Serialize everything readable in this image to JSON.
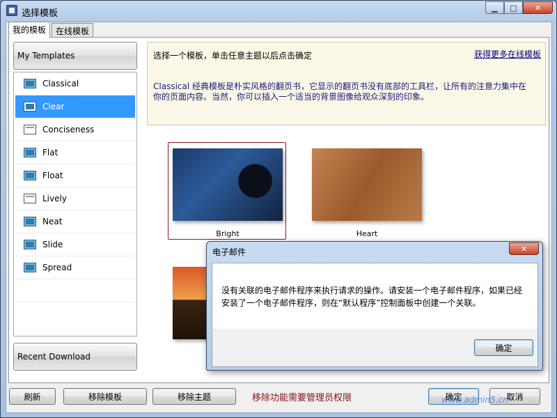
{
  "window": {
    "title": "选择模板",
    "controls": {
      "minimize": "▁",
      "maximize": "□",
      "close": "✕"
    }
  },
  "tabs": [
    {
      "label": "我的模板",
      "active": true
    },
    {
      "label": "在线模板",
      "active": false
    }
  ],
  "left_panel": {
    "header": "My Templates",
    "items": [
      {
        "label": "Classical",
        "icon": "classical-template-icon"
      },
      {
        "label": "Clear",
        "icon": "clear-template-icon",
        "selected": true
      },
      {
        "label": "Conciseness",
        "icon": "conciseness-template-icon"
      },
      {
        "label": "Flat",
        "icon": "flat-template-icon"
      },
      {
        "label": "Float",
        "icon": "float-template-icon"
      },
      {
        "label": "Lively",
        "icon": "lively-template-icon"
      },
      {
        "label": "Neat",
        "icon": "neat-template-icon"
      },
      {
        "label": "Slide",
        "icon": "slide-template-icon"
      },
      {
        "label": "Spread",
        "icon": "spread-template-icon"
      }
    ],
    "footer": "Recent Download"
  },
  "info": {
    "title": "选择一个模板，单击任意主题以后点击确定",
    "link": "获得更多在线模板",
    "description": "Classical 经典模板是朴实风格的翻页书，它显示的翻页书没有底部的工具栏，让所有的注意力集中在你的页面内容。当然，你可以插入一个适当的背景图像给观众深刻的印象。"
  },
  "themes": [
    {
      "label": "Bright",
      "selected": true
    },
    {
      "label": "Heart",
      "selected": false
    },
    {
      "label": "",
      "selected": false
    }
  ],
  "bottom": {
    "refresh": "刷新",
    "remove_template": "移除模板",
    "remove_theme": "移除主题",
    "warning": "移除功能需要管理员权限",
    "ok": "确定",
    "cancel": "取消",
    "watermark": "www.admin5.cn"
  },
  "dialog": {
    "title": "电子邮件",
    "close": "✕",
    "message": "没有关联的电子邮件程序来执行请求的操作。请安装一个电子邮件程序，如果已经安装了一个电子邮件程序，则在“默认程序”控制面板中创建一个关联。",
    "ok": "确定"
  },
  "colors": {
    "selection": "#3399ff",
    "info_background": "#fbf7e7",
    "warning_text": "#8b0f0f"
  }
}
